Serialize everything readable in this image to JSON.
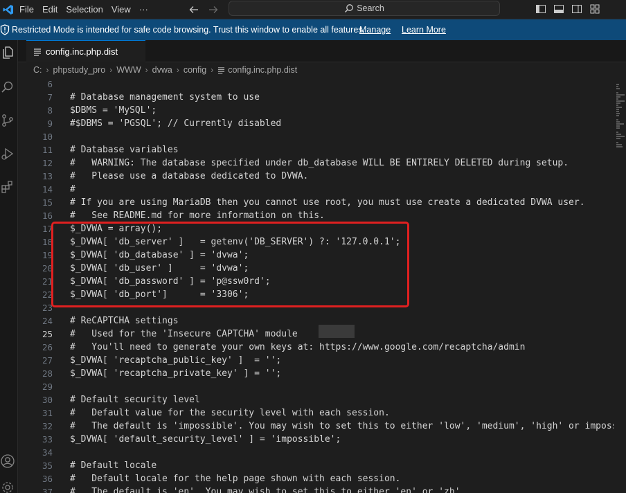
{
  "menubar": {
    "items": [
      "File",
      "Edit",
      "Selection",
      "View",
      "···"
    ]
  },
  "command_center": {
    "label": "Search",
    "icon": "search-icon"
  },
  "banner": {
    "message": "Restricted Mode is intended for safe code browsing. Trust this window to enable all features.",
    "manage_link": "Manage",
    "learn_more_link": "Learn More",
    "background": "#0e4a79"
  },
  "tab": {
    "label": "config.inc.php.dist",
    "icon": "file-lines-icon"
  },
  "breadcrumb": [
    "C:",
    "phpstudy_pro",
    "WWW",
    "dvwa",
    "config",
    "config.inc.php.dist"
  ],
  "editor": {
    "active_line": 25,
    "highlight_color": "#e02020",
    "lines": [
      {
        "n": "6",
        "text": ""
      },
      {
        "n": "7",
        "text": "# Database management system to use"
      },
      {
        "n": "8",
        "text": "$DBMS = 'MySQL';"
      },
      {
        "n": "9",
        "text": "#$DBMS = 'PGSQL'; // Currently disabled"
      },
      {
        "n": "10",
        "text": ""
      },
      {
        "n": "11",
        "text": "# Database variables"
      },
      {
        "n": "12",
        "text": "#   WARNING: The database specified under db_database WILL BE ENTIRELY DELETED during setup."
      },
      {
        "n": "13",
        "text": "#   Please use a database dedicated to DVWA."
      },
      {
        "n": "14",
        "text": "#"
      },
      {
        "n": "15",
        "text": "# If you are using MariaDB then you cannot use root, you must use create a dedicated DVWA user."
      },
      {
        "n": "16",
        "text": "#   See README.md for more information on this."
      },
      {
        "n": "17",
        "text": "$_DVWA = array();"
      },
      {
        "n": "18",
        "text": "$_DVWA[ 'db_server' ]   = getenv('DB_SERVER') ?: '127.0.0.1';"
      },
      {
        "n": "19",
        "text": "$_DVWA[ 'db_database' ] = 'dvwa';"
      },
      {
        "n": "20",
        "text": "$_DVWA[ 'db_user' ]     = 'dvwa';"
      },
      {
        "n": "21",
        "text": "$_DVWA[ 'db_password' ] = 'p@ssw0rd';"
      },
      {
        "n": "22",
        "text": "$_DVWA[ 'db_port']      = '3306';"
      },
      {
        "n": "23",
        "text": ""
      },
      {
        "n": "24",
        "text": "# ReCAPTCHA settings"
      },
      {
        "n": "25",
        "text": "#   Used for the 'Insecure CAPTCHA' module"
      },
      {
        "n": "26",
        "text": "#   You'll need to generate your own keys at: https://www.google.com/recaptcha/admin"
      },
      {
        "n": "27",
        "text": "$_DVWA[ 'recaptcha_public_key' ]  = '';"
      },
      {
        "n": "28",
        "text": "$_DVWA[ 'recaptcha_private_key' ] = '';"
      },
      {
        "n": "29",
        "text": ""
      },
      {
        "n": "30",
        "text": "# Default security level"
      },
      {
        "n": "31",
        "text": "#   Default value for the security level with each session."
      },
      {
        "n": "32",
        "text": "#   The default is 'impossible'. You may wish to set this to either 'low', 'medium', 'high' or impossi"
      },
      {
        "n": "33",
        "text": "$_DVWA[ 'default_security_level' ] = 'impossible';"
      },
      {
        "n": "34",
        "text": ""
      },
      {
        "n": "35",
        "text": "# Default locale"
      },
      {
        "n": "36",
        "text": "#   Default locale for the help page shown with each session."
      },
      {
        "n": "37",
        "text": "#   The default is 'en'. You may wish to set this to either 'en' or 'zh'."
      }
    ]
  }
}
